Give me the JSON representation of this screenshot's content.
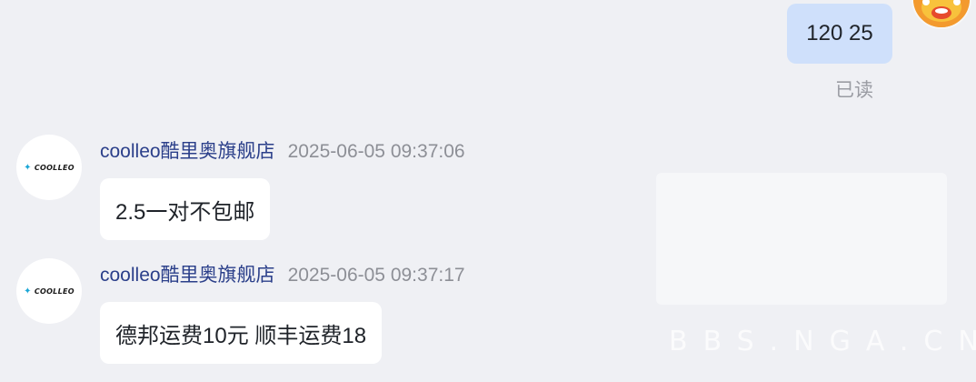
{
  "my_message": {
    "text": "120 25",
    "status": "已读"
  },
  "messages": [
    {
      "sender": "coolleo酷里奥旗舰店",
      "time": "2025-06-05 09:37:06",
      "text": "2.5一对不包邮",
      "avatar_logo": "COOLLEO"
    },
    {
      "sender": "coolleo酷里奥旗舰店",
      "time": "2025-06-05 09:37:17",
      "text": "德邦运费10元 顺丰运费18",
      "avatar_logo": "COOLLEO"
    }
  ],
  "watermark": {
    "text": "BBS.NGA.CN"
  },
  "colors": {
    "background": "#eff0f4",
    "my_bubble": "#cfe0fb",
    "sender_name": "#2b3f8a",
    "logo_accent": "#1aa6d6"
  }
}
